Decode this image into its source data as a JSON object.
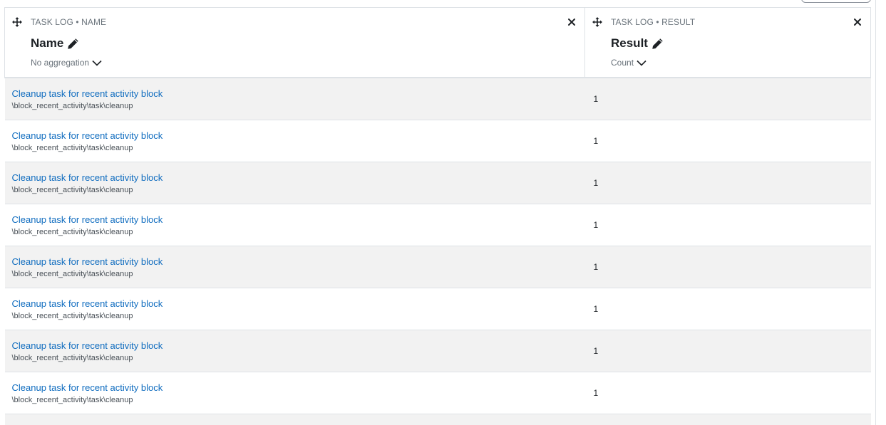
{
  "columns": {
    "name": {
      "source": "TASK LOG • NAME",
      "title": "Name",
      "aggregation": "No aggregation"
    },
    "result": {
      "source": "TASK LOG • RESULT",
      "title": "Result",
      "aggregation": "Count"
    }
  },
  "rows": [
    {
      "name": "Cleanup task for recent activity block",
      "classname": "\\block_recent_activity\\task\\cleanup",
      "result": "1"
    },
    {
      "name": "Cleanup task for recent activity block",
      "classname": "\\block_recent_activity\\task\\cleanup",
      "result": "1"
    },
    {
      "name": "Cleanup task for recent activity block",
      "classname": "\\block_recent_activity\\task\\cleanup",
      "result": "1"
    },
    {
      "name": "Cleanup task for recent activity block",
      "classname": "\\block_recent_activity\\task\\cleanup",
      "result": "1"
    },
    {
      "name": "Cleanup task for recent activity block",
      "classname": "\\block_recent_activity\\task\\cleanup",
      "result": "1"
    },
    {
      "name": "Cleanup task for recent activity block",
      "classname": "\\block_recent_activity\\task\\cleanup",
      "result": "1"
    },
    {
      "name": "Cleanup task for recent activity block",
      "classname": "\\block_recent_activity\\task\\cleanup",
      "result": "1"
    },
    {
      "name": "Cleanup task for recent activity block",
      "classname": "\\block_recent_activity\\task\\cleanup",
      "result": "1"
    }
  ],
  "colors": {
    "link": "#0f6cbf",
    "stripe": "#f2f2f2",
    "border": "#dee2e6",
    "muted": "#6a737b"
  },
  "icons": [
    "move-icon",
    "close-icon",
    "pencil-icon",
    "chevron-down-icon"
  ]
}
